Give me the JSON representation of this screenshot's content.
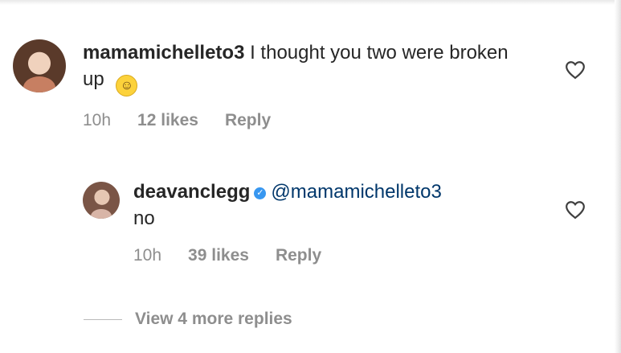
{
  "comments": [
    {
      "username": "mamamichelleto3",
      "text": "I thought you two were broken up",
      "emoji_icon": "smiling-face-with-tear-emoji",
      "time": "10h",
      "likes": "12 likes",
      "reply_label": "Reply",
      "like_icon": "heart-outline-icon"
    }
  ],
  "reply": {
    "username": "deavanclegg",
    "verified_icon": "verified-badge-icon",
    "mention": "@mamamichelleto3",
    "text": "no",
    "time": "10h",
    "likes": "39 likes",
    "reply_label": "Reply",
    "like_icon": "heart-outline-icon"
  },
  "view_more": {
    "label": "View 4 more replies"
  },
  "colors": {
    "text": "#262626",
    "muted": "#8e8e8e",
    "mention": "#00376b",
    "verified": "#3897f0"
  }
}
